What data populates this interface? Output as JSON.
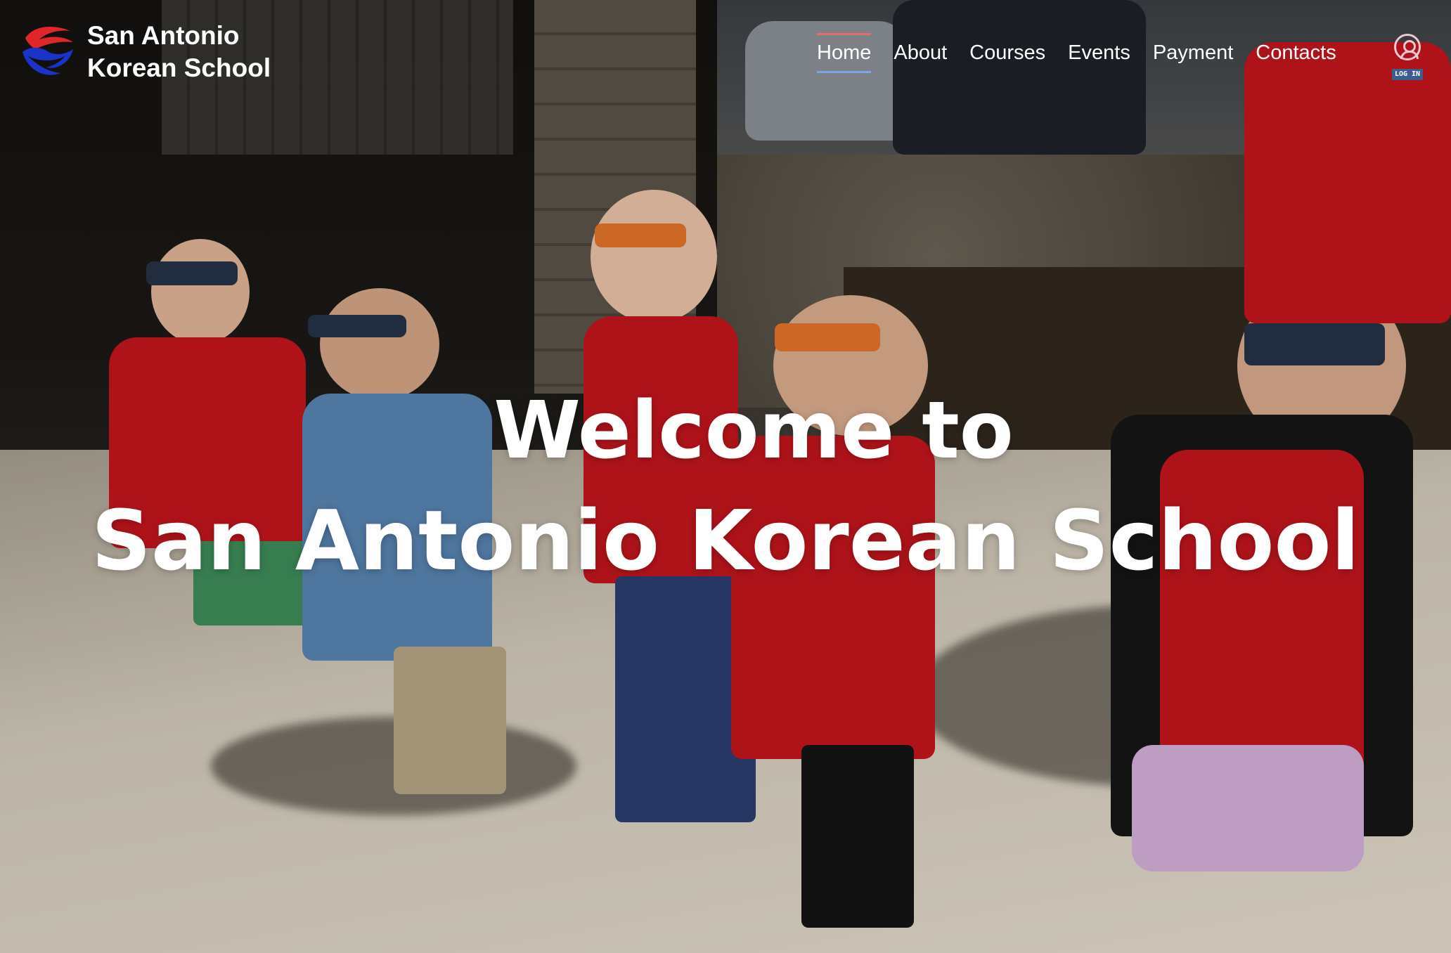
{
  "site": {
    "brand_line1": "San Antonio",
    "brand_line2": "Korean School",
    "logo_icon": "taegeuk-wave-logo-icon",
    "brand_colors": {
      "red": "#e0262b",
      "blue": "#1b33c9",
      "white": "#ffffff"
    }
  },
  "nav": {
    "items": [
      {
        "label": "Home",
        "active": true
      },
      {
        "label": "About",
        "active": false
      },
      {
        "label": "Courses",
        "active": false
      },
      {
        "label": "Events",
        "active": false
      },
      {
        "label": "Payment",
        "active": false
      },
      {
        "label": "Contacts",
        "active": false
      }
    ],
    "active_underline_colors": {
      "top": "#e86b6b",
      "bottom": "#7ea3e8"
    },
    "login_label": "LOG IN",
    "login_icon": "user-circle-icon"
  },
  "hero": {
    "title_line1": "Welcome to",
    "title_line2": "San Antonio Korean School",
    "image_subject": "children wearing eclipse glasses looking up at the sky"
  }
}
